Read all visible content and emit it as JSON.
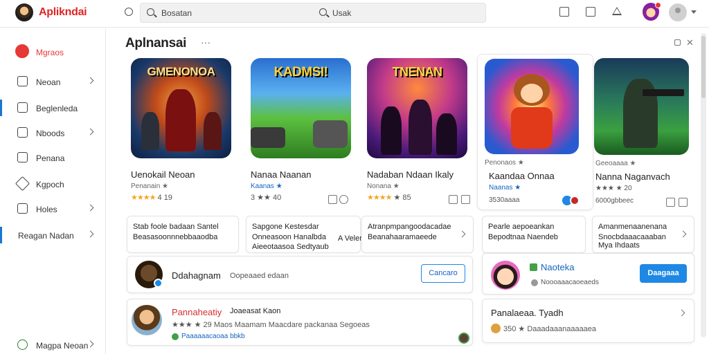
{
  "app": {
    "brand": "Aplikndai"
  },
  "search": {
    "placeholder": "Bosatan",
    "secondary": "Usak"
  },
  "sidebar": {
    "items": [
      {
        "label": "Mgraos"
      },
      {
        "label": "Neoan"
      },
      {
        "label": "Beglenleda"
      },
      {
        "label": "Nboods"
      },
      {
        "label": "Penana"
      },
      {
        "label": "Kgpoch"
      },
      {
        "label": "Holes"
      },
      {
        "label": "Reagan Nadan"
      },
      {
        "label": "Magpa Neoan"
      }
    ]
  },
  "main": {
    "title": "Aplnansai",
    "more": "···",
    "cards": [
      {
        "art": "GMENONOA",
        "name": "Uenokail Neoan",
        "sub": "Penanain ★",
        "stars": "★★★★",
        "rating": "4  19"
      },
      {
        "art": "KADMSI!",
        "name": "Nanaa Naanan",
        "sub": "Kaanas ★",
        "stars": "★★★★",
        "rating": "3 ★★ 40"
      },
      {
        "art": "TNENAN",
        "name": "Nadaban Ndaan Ikaly",
        "sub": "Nonana ★",
        "stars": "★★★★",
        "rating": "★ 85"
      },
      {
        "art": "",
        "top": "Penonaos ★",
        "name": "Kaandaa Onnaa",
        "sub": "Naanas ★",
        "stars": "",
        "rating": "3530aaaa"
      },
      {
        "art": "",
        "top": "Geeoaaaa ★",
        "name": "Nanna Naganvach",
        "sub": "★★★ ★ 20",
        "stars": "",
        "rating": "6000gbbeec"
      }
    ],
    "promos": [
      {
        "l1": "Stab foole badaan Santel",
        "l2": "Beasasoonnnebbaaodba"
      },
      {
        "l1": "Sapgone Kestesdar",
        "l2": "Onneasoon Hanalbda",
        "l3": "A Veler",
        "l4": "Aieeotaasoa Sedtyaub"
      },
      {
        "l1": "Atranpmpangoodacadae",
        "l2": "Beanahaaramaeede"
      },
      {
        "l1": "Pearle aepoeankan",
        "l2": "Bepodtnaa Naendeb"
      },
      {
        "l1": "Amanmenaanenana",
        "l2": "Snocbdaaacaaaban",
        "l3": "Mya Ihdaats"
      }
    ],
    "featured": [
      {
        "title": "Ddahagnam",
        "sub": "Oopeaaed edaan",
        "button": "Cancaro"
      },
      {
        "title": "Naoteka",
        "sub": "Noooaaacaoeaeds",
        "button": "Daagaaa"
      },
      {
        "title": "Pannaheatiy",
        "title2": "Joaeasat Kaon",
        "sub": "★★★ ★ 29  Maos Maamam  Maacdare packanaa  Segoeas",
        "sub2": "Paaaaaacaoaa bbkb"
      },
      {
        "title": "Panalaeaa. Tyadh",
        "sub": "350 ★ Daaadaaanaaaaaea"
      }
    ]
  },
  "colors": {
    "brand": "#e02424",
    "accent": "#1e88e5",
    "star": "#f5a623"
  }
}
